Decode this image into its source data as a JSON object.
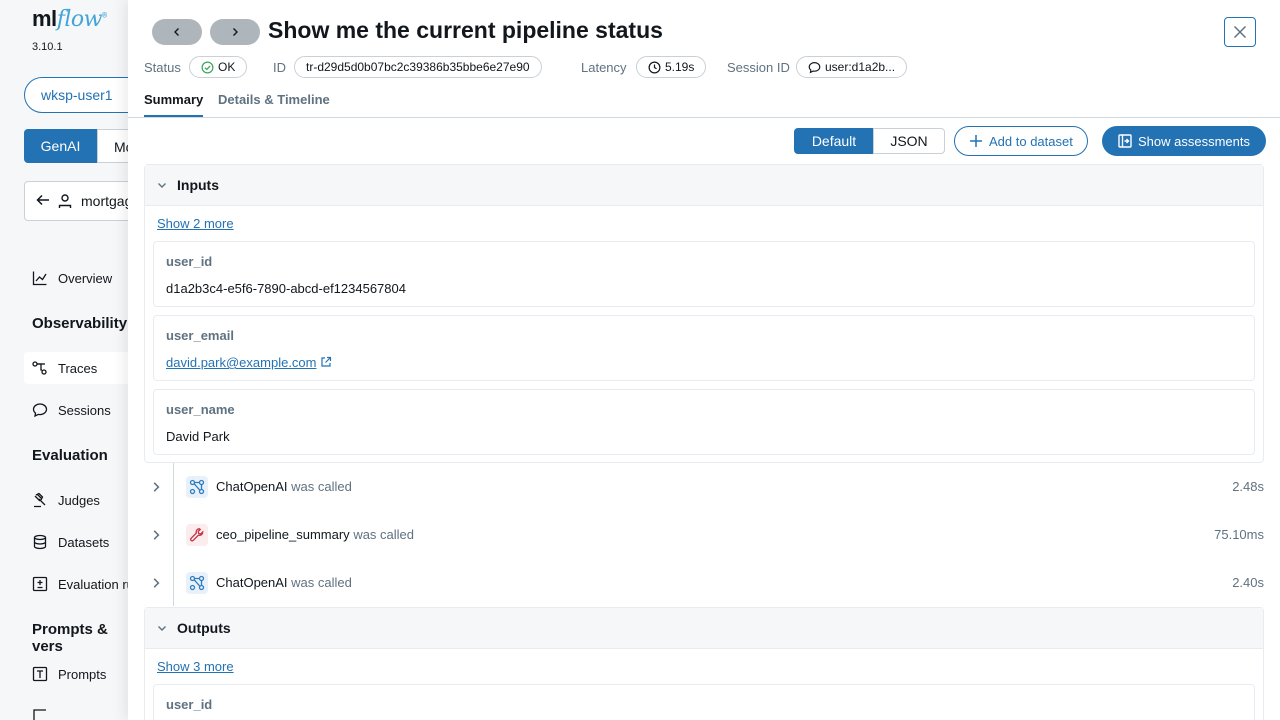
{
  "sidebar": {
    "logo_ml": "ml",
    "logo_flow": "flow",
    "version": "3.10.1",
    "workspace": "wksp-user1",
    "mode_genai": "GenAI",
    "mode_ml": "Mc",
    "experiment_name": "mortgag",
    "items": {
      "overview": "Overview",
      "observability": "Observability",
      "traces": "Traces",
      "sessions": "Sessions",
      "evaluation": "Evaluation",
      "judges": "Judges",
      "datasets": "Datasets",
      "evaluation_runs": "Evaluation ru",
      "prompts_section": "Prompts & vers",
      "prompts": "Prompts"
    }
  },
  "drawer": {
    "title": "Show me the current pipeline status",
    "status_label": "Status",
    "status_value": "OK",
    "id_label": "ID",
    "id_value": "tr-d29d5d0b07bc2c39386b35bbe6e27e90",
    "latency_label": "Latency",
    "latency_value": "5.19s",
    "session_label": "Session ID",
    "session_value": "user:d1a2b...",
    "tabs": [
      "Summary",
      "Details & Timeline"
    ],
    "view_default": "Default",
    "view_json": "JSON",
    "add_dataset": "Add to dataset",
    "show_assessments": "Show assessments",
    "inputs": {
      "title": "Inputs",
      "show_more": "Show 2 more",
      "fields": [
        {
          "key": "user_id",
          "value": "d1a2b3c4-e5f6-7890-abcd-ef1234567804"
        },
        {
          "key": "user_email",
          "value": "david.park@example.com"
        },
        {
          "key": "user_name",
          "value": "David Park"
        }
      ]
    },
    "spans": [
      {
        "name": "ChatOpenAI",
        "suffix": "was called",
        "duration": "2.48s",
        "icon": "llm-network-icon"
      },
      {
        "name": "ceo_pipeline_summary",
        "suffix": "was called",
        "duration": "75.10ms",
        "icon": "tool-wrench-icon"
      },
      {
        "name": "ChatOpenAI",
        "suffix": "was called",
        "duration": "2.40s",
        "icon": "llm-network-icon"
      }
    ],
    "outputs": {
      "title": "Outputs",
      "show_more": "Show 3 more",
      "first_key": "user_id"
    }
  },
  "colors": {
    "accent": "#2272b4",
    "ok_green": "#3ba55c",
    "tool_red": "#c83243",
    "llm_blue": "#2f7dbf"
  }
}
